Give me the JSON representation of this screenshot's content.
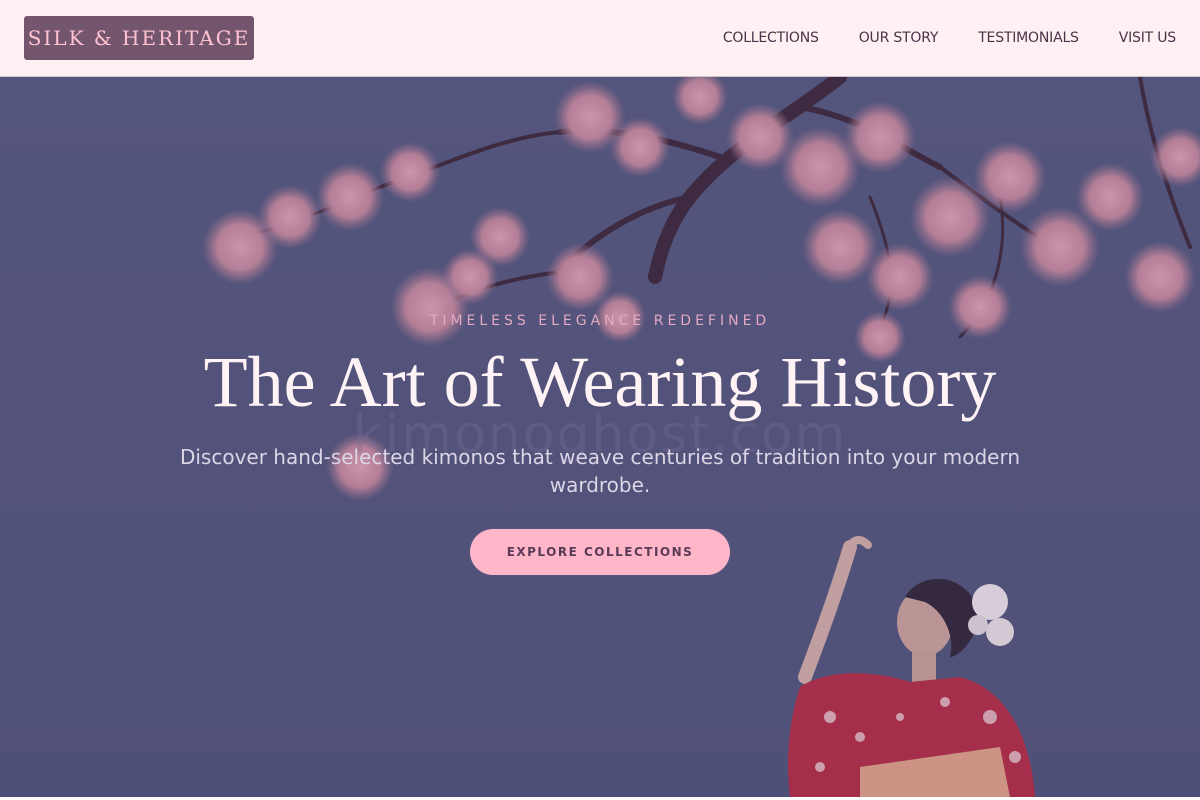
{
  "header": {
    "logo_text": "SILK & HERITAGE",
    "nav": [
      {
        "label": "COLLECTIONS"
      },
      {
        "label": "OUR STORY"
      },
      {
        "label": "TESTIMONIALS"
      },
      {
        "label": "VISIT US"
      }
    ]
  },
  "hero": {
    "eyebrow": "TIMELESS ELEGANCE REDEFINED",
    "headline": "The Art of Wearing History",
    "watermark": "kimonoghost.com",
    "subtitle": "Discover hand-selected kimonos that weave centuries of tradition into your modern wardrobe.",
    "cta_label": "EXPLORE COLLECTIONS",
    "image_subject": "cherry-blossom-branches-and-woman-in-red-kimono"
  },
  "colors": {
    "header_bg": "#fff0f3",
    "logo_bg": "#73566d",
    "logo_text": "#ffc2d1",
    "hero_overlay": "#525478",
    "cta_bg": "#ffb6c8",
    "eyebrow": "#e3a9c3"
  }
}
